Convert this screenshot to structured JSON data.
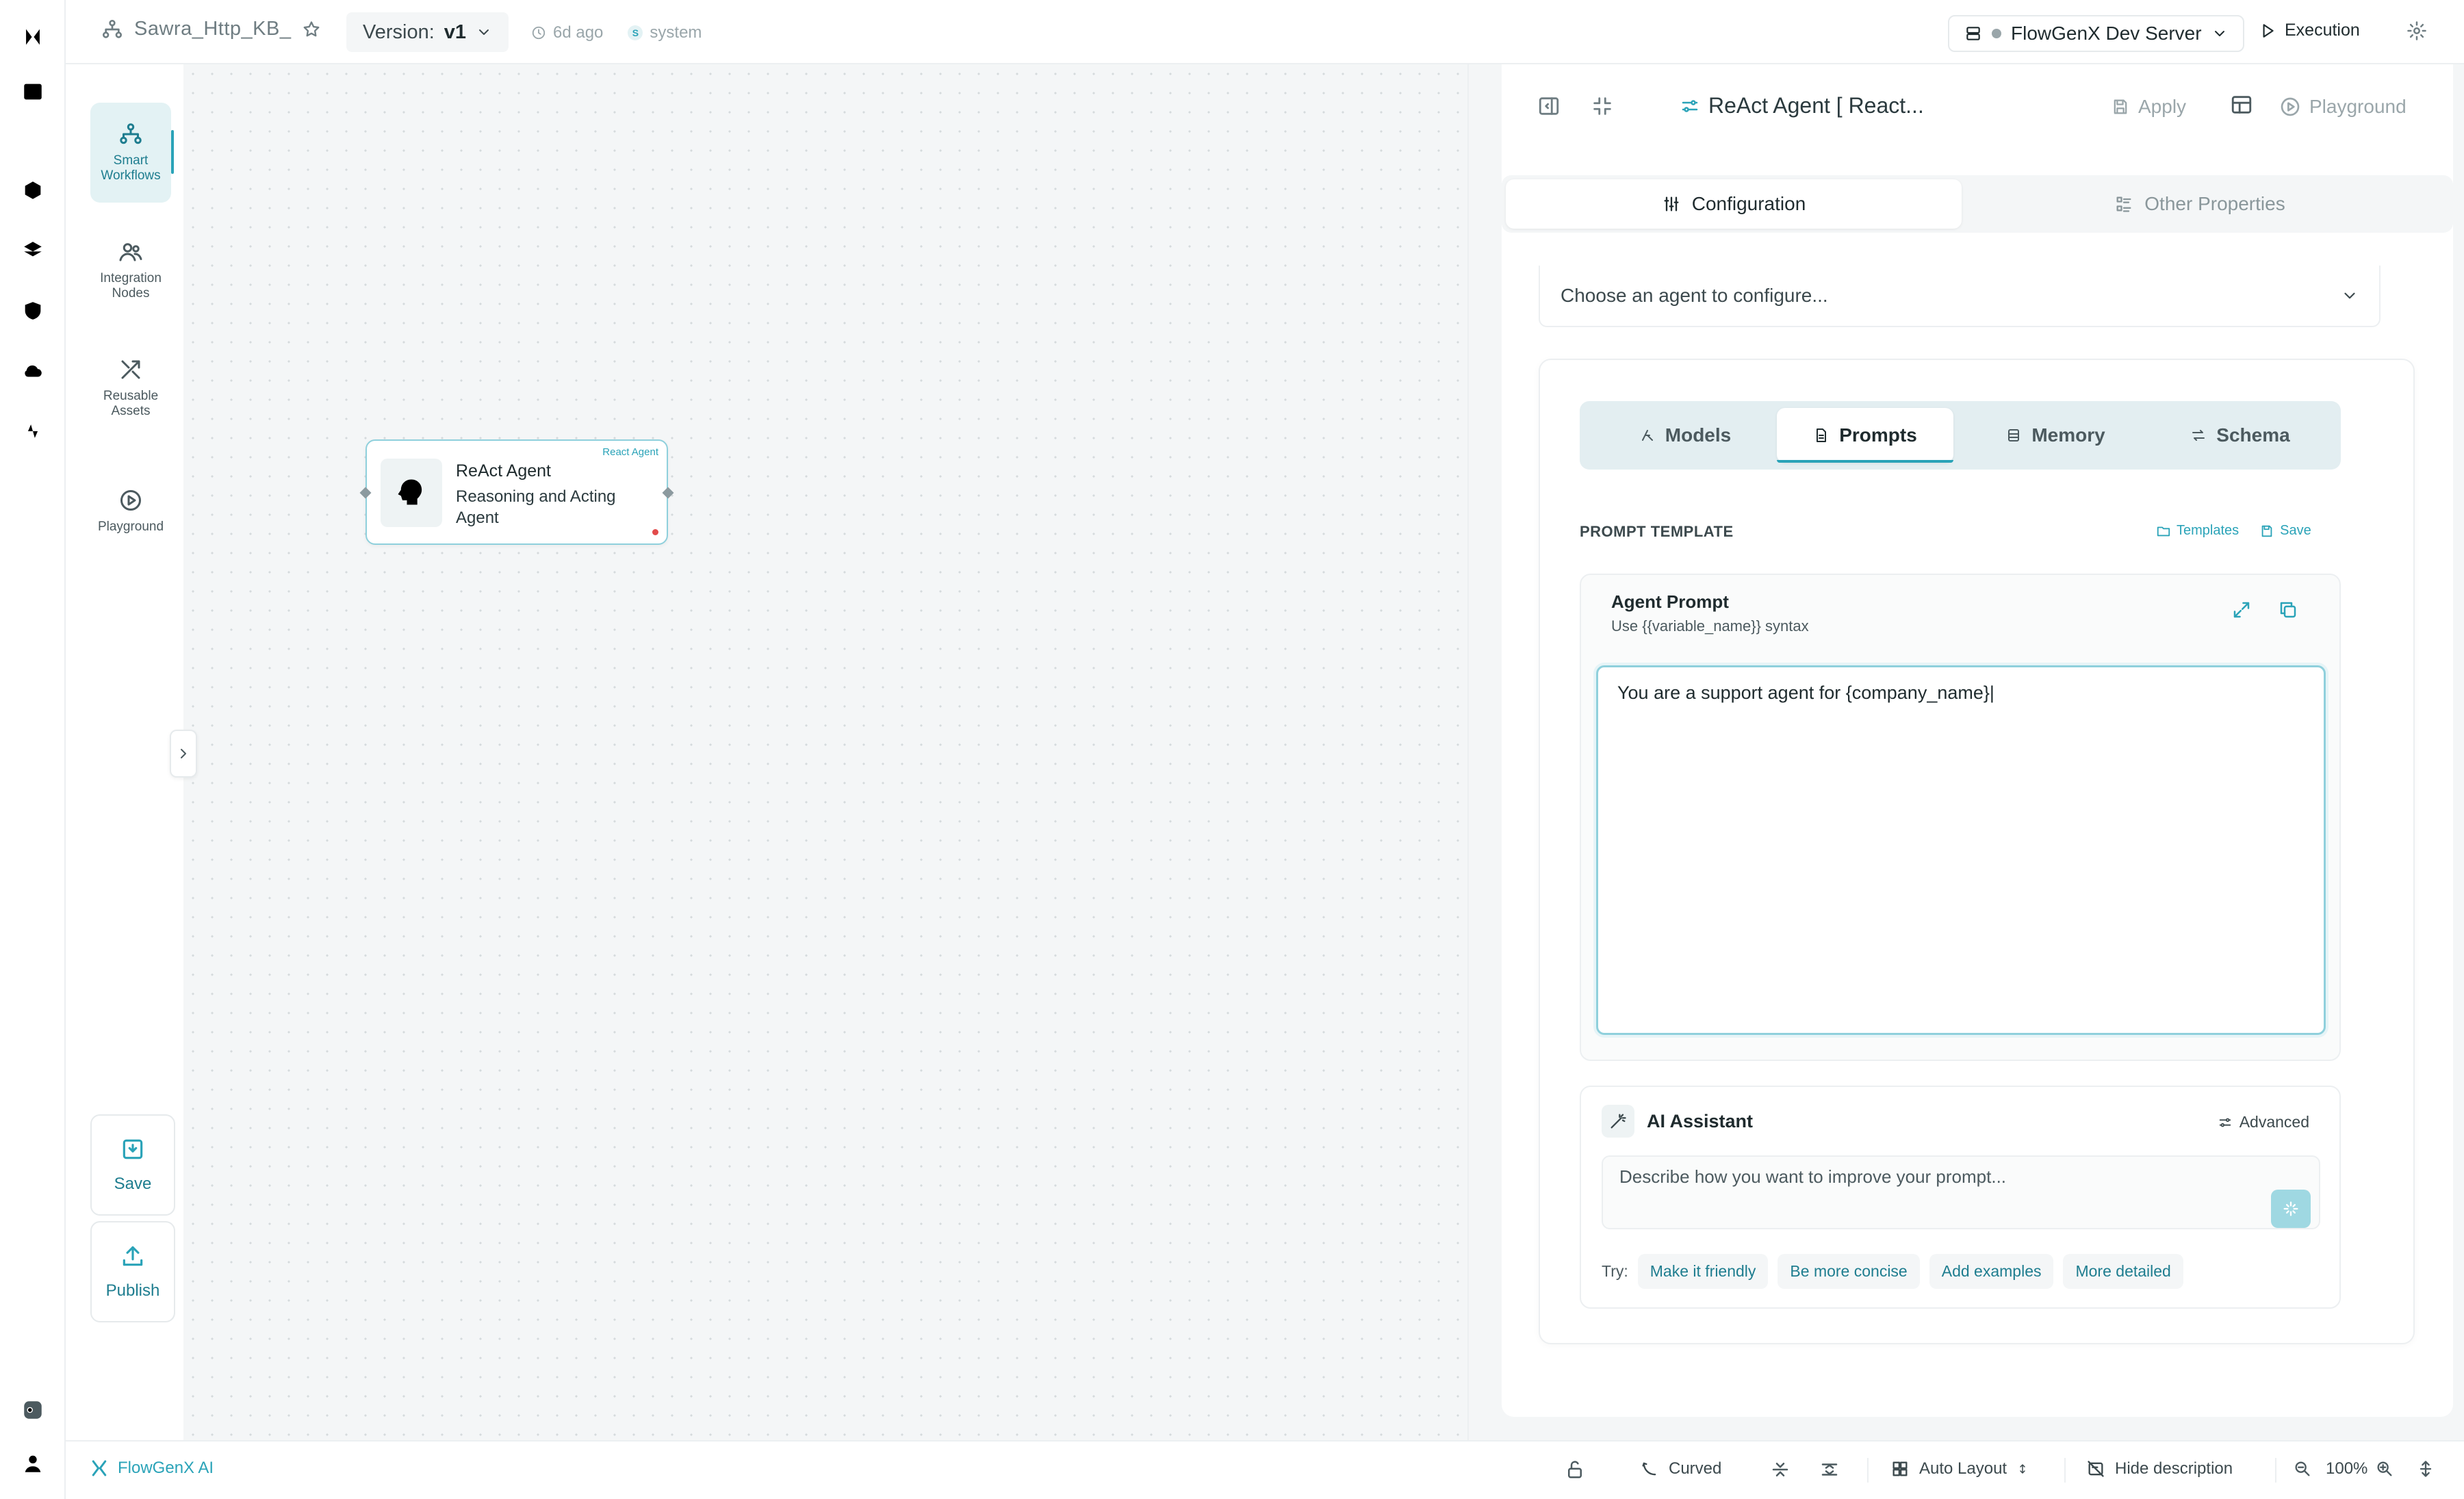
{
  "topbar": {
    "workflow_name": "Sawra_Http_KB_",
    "version_label": "Version:",
    "version_value": "v1",
    "updated": "6d ago",
    "user_initial": "S",
    "user": "system",
    "server": "FlowGenX Dev Server",
    "execution": "Execution"
  },
  "sidebar": {
    "items": [
      {
        "label": "Smart Workflows",
        "icon": "workflow-icon"
      },
      {
        "label": "Integration Nodes",
        "icon": "users-icon"
      },
      {
        "label": "Reusable Assets",
        "icon": "tools-icon"
      },
      {
        "label": "Playground",
        "icon": "play-circle-icon"
      }
    ],
    "save": "Save",
    "publish": "Publish"
  },
  "node": {
    "tag": "React Agent",
    "title": "ReAct Agent",
    "description": "Reasoning and Acting Agent"
  },
  "panel": {
    "title": "ReAct Agent [ React...",
    "apply": "Apply",
    "playground": "Playground",
    "tabs": [
      "Configuration",
      "Other Properties"
    ],
    "agent_select_placeholder": "Choose an agent to configure...",
    "subtabs": [
      "Models",
      "Prompts",
      "Memory",
      "Schema"
    ],
    "section_label": "PROMPT TEMPLATE",
    "templates": "Templates",
    "save": "Save",
    "prompt_title": "Agent Prompt",
    "prompt_hint": "Use {{variable_name}} syntax",
    "prompt_value": "You are a support agent for {company_name}|",
    "ai": {
      "title": "AI Assistant",
      "advanced": "Advanced",
      "placeholder": "Describe how you want to improve your prompt...",
      "try_label": "Try:",
      "suggestions": [
        "Make it friendly",
        "Be more concise",
        "Add examples",
        "More detailed"
      ]
    }
  },
  "bottombar": {
    "brand": "FlowGenX AI",
    "edge_style": "Curved",
    "auto_layout": "Auto Layout",
    "hide_description": "Hide description",
    "zoom": "100%"
  },
  "colors": {
    "accent": "#2aa3b8",
    "active_bg": "#e3f2f4",
    "error": "#e24b4b"
  }
}
